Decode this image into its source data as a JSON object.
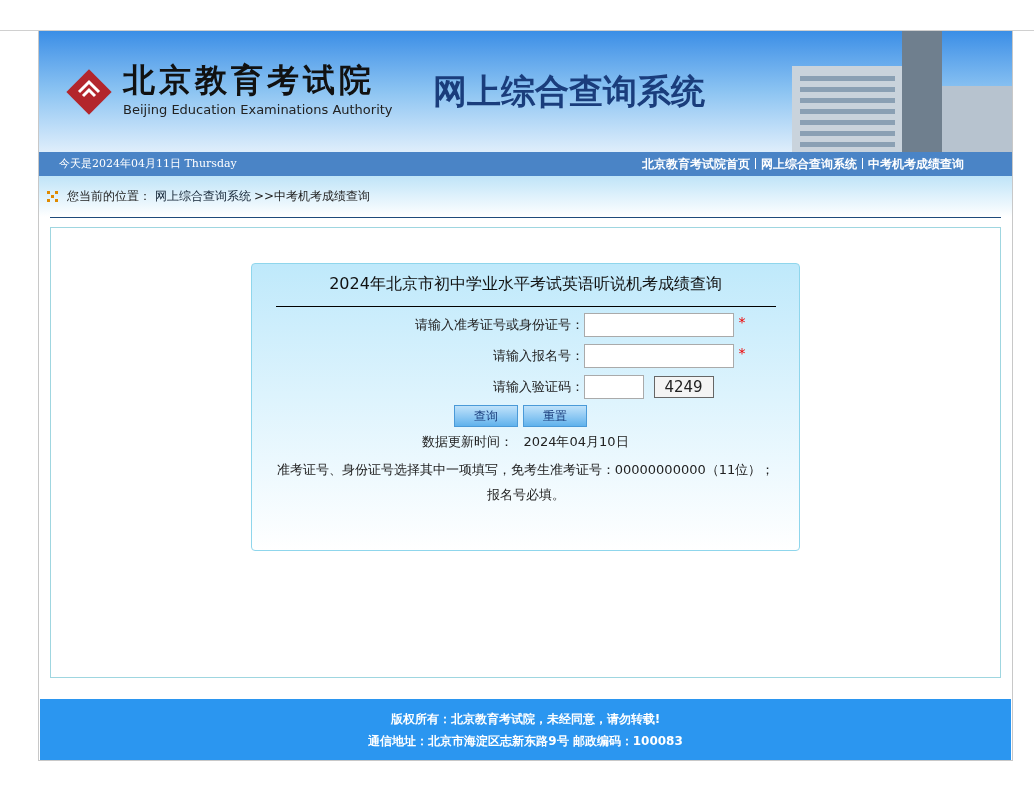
{
  "banner": {
    "org_name": "北京教育考试院",
    "org_name_en": "Beijing Education Examinations Authority",
    "system_title": "网上综合查询系统"
  },
  "nav": {
    "date": "今天是2024年04月11日 Thursday",
    "links": [
      "北京教育考试院首页",
      "网上综合查询系统",
      "中考机考成绩查询"
    ]
  },
  "breadcrumb": {
    "label": "您当前的位置：",
    "link": "网上综合查询系统",
    "current": ">>中考机考成绩查询"
  },
  "form": {
    "title": "2024年北京市初中学业水平考试英语听说机考成绩查询",
    "fields": [
      {
        "label": "请输入准考证号或身份证号：",
        "kind": "text",
        "mark": "*"
      },
      {
        "label": "请输入报名号：",
        "kind": "text",
        "mark": "*"
      },
      {
        "label": "请输入验证码：",
        "kind": "captcha",
        "captcha": "4249"
      }
    ],
    "buttons": [
      "查询",
      "重置"
    ],
    "update_label": "数据更新时间：",
    "update_value": "2024年04月10日",
    "note": "准考证号、身份证号选择其中一项填写，免考生准考证号：00000000000（11位）；报名号必填。"
  },
  "footer": [
    "版权所有：北京教育考试院，未经同意，请勿转载!",
    "通信地址：北京市海淀区志新东路9号 邮政编码：100083"
  ]
}
